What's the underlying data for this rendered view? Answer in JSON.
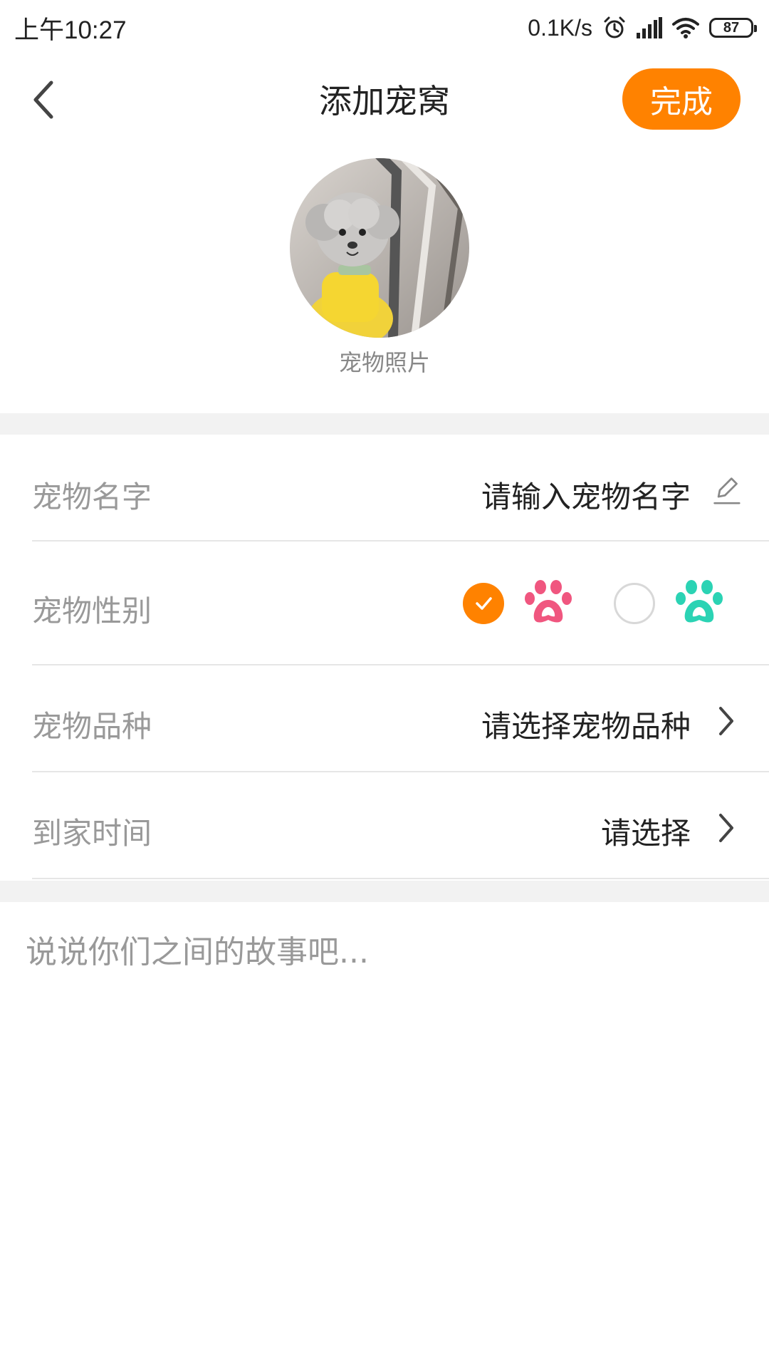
{
  "status_bar": {
    "time": "上午10:27",
    "net_speed": "0.1K/s",
    "battery": "87",
    "icons": [
      "alarm-icon",
      "signal-icon",
      "wifi-icon",
      "battery-icon"
    ]
  },
  "header": {
    "title": "添加宠窝",
    "back_icon": "chevron-left-icon",
    "done_label": "完成"
  },
  "avatar": {
    "caption": "宠物照片"
  },
  "form": {
    "name": {
      "label": "宠物名字",
      "placeholder": "请输入宠物名字",
      "icon": "edit-pencil-icon"
    },
    "gender": {
      "label": "宠物性别",
      "options": [
        {
          "icon": "paw-icon",
          "color": "#f0567f",
          "selected": true
        },
        {
          "icon": "paw-icon",
          "color": "#2bd3b4",
          "selected": false
        }
      ]
    },
    "breed": {
      "label": "宠物品种",
      "value": "请选择宠物品种",
      "icon": "chevron-right-icon"
    },
    "home_time": {
      "label": "到家时间",
      "value": "请选择",
      "icon": "chevron-right-icon"
    }
  },
  "story": {
    "placeholder": "说说你们之间的故事吧..."
  },
  "colors": {
    "accent": "#ff8200",
    "paw_pink": "#f0567f",
    "paw_teal": "#2bd3b4"
  }
}
